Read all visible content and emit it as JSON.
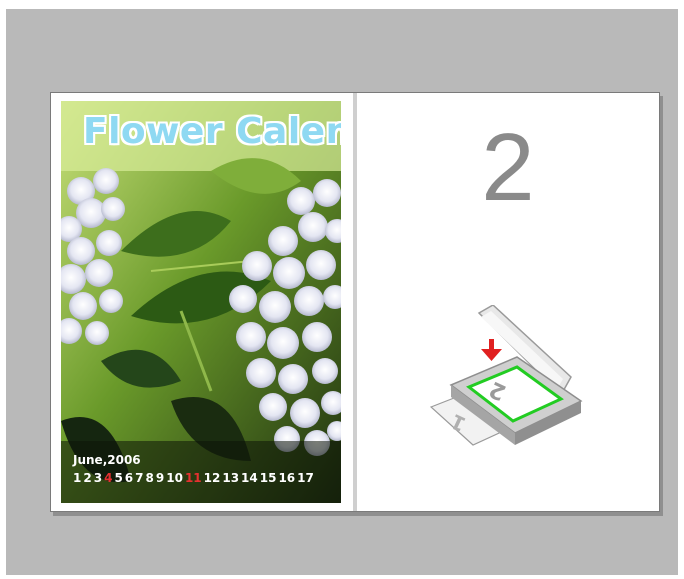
{
  "preview": {
    "left_page": {
      "title": "Flower Calendar",
      "month": "June,2006",
      "days": [
        "1",
        "2",
        "3",
        "4",
        "5",
        "6",
        "7",
        "8",
        "9",
        "10",
        "11",
        "12",
        "13",
        "14",
        "15",
        "16",
        "17"
      ],
      "highlighted_days": [
        "4",
        "11"
      ]
    },
    "right_page": {
      "page_number": "2",
      "scanner_icon_labels": [
        "2",
        "1"
      ]
    }
  },
  "colors": {
    "background": "#b9b9b9",
    "title": "#8fd9f2",
    "page_number": "#8a8a8a",
    "scan_frame": "#22cc22",
    "arrow": "#e02020"
  }
}
